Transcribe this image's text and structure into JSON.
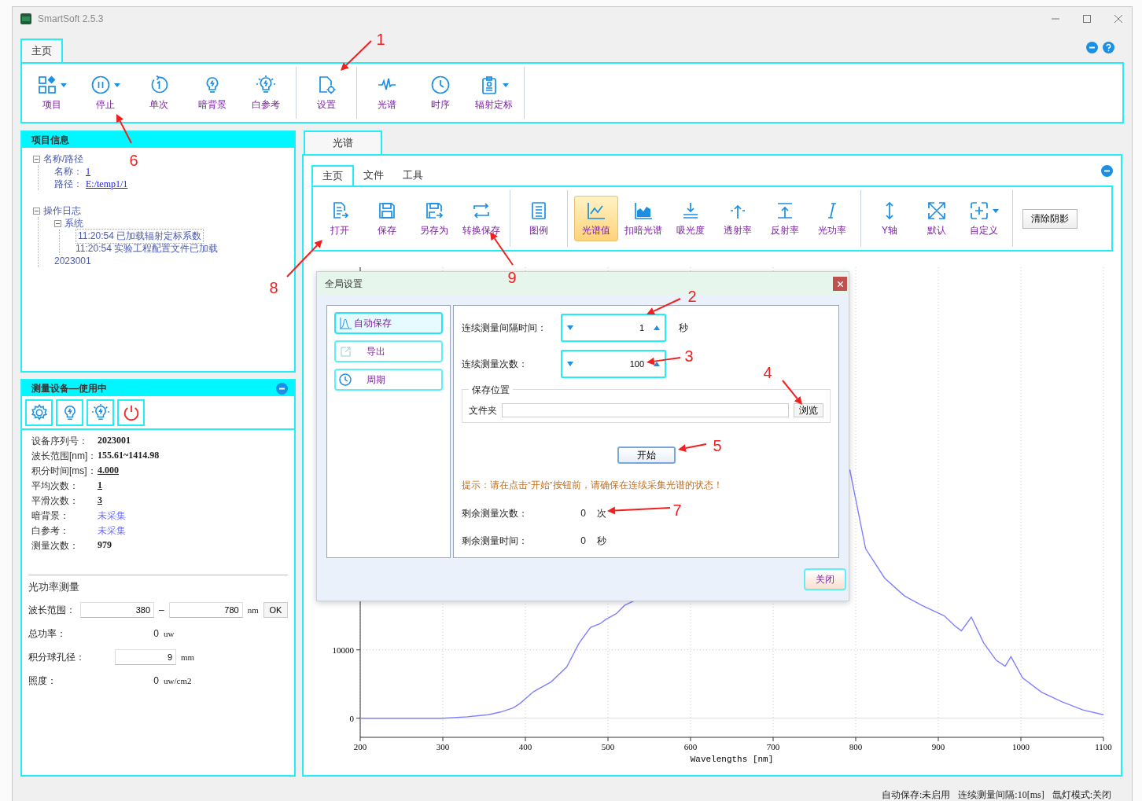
{
  "window": {
    "title": "SmartSoft 2.5.3"
  },
  "ribbon": {
    "tabs": [
      {
        "label": "主页",
        "selected": true
      }
    ],
    "groups": [
      [
        {
          "label": "项目",
          "dropdown": true
        },
        {
          "label": "停止",
          "dropdown": true
        },
        {
          "label": "单次",
          "dropdown": false
        },
        {
          "label": "暗背景",
          "dropdown": false
        },
        {
          "label": "白参考",
          "dropdown": false
        }
      ],
      [
        {
          "label": "设置",
          "dropdown": false
        }
      ],
      [
        {
          "label": "光谱",
          "dropdown": false
        },
        {
          "label": "时序",
          "dropdown": false
        },
        {
          "label": "辐射定标",
          "dropdown": true
        }
      ]
    ]
  },
  "project_panel": {
    "title": "项目信息",
    "tree": [
      {
        "label": "名称/路径",
        "expanded": true,
        "children": [
          {
            "label": "名称：",
            "value": "1"
          },
          {
            "label": "路径：",
            "value": "E:/temp1/1"
          }
        ]
      },
      {
        "label": "操作日志",
        "expanded": true,
        "children": [
          {
            "label": "系统",
            "expanded": true,
            "children": [
              {
                "label": "11:20:54 已加载辐射定标系数",
                "selected": true
              },
              {
                "label": "11:20:54 实验工程配置文件已加载",
                "selected": false
              }
            ]
          },
          {
            "label": "2023001"
          }
        ]
      }
    ]
  },
  "device_panel": {
    "title": "测量设备—使用中",
    "info": [
      {
        "label": "设备序列号：",
        "value": "2023001",
        "kind": "plain"
      },
      {
        "label": "波长范围[nm]：",
        "value": "155.61~1414.98",
        "kind": "plain"
      },
      {
        "label": "积分时间[ms]：",
        "value": "4.000",
        "kind": "link"
      },
      {
        "label": "平均次数：",
        "value": "1",
        "kind": "link"
      },
      {
        "label": "平滑次数：",
        "value": "3",
        "kind": "link"
      },
      {
        "label": "暗背景：",
        "value": "未采集",
        "kind": "status"
      },
      {
        "label": "白参考：",
        "value": "未采集",
        "kind": "status"
      },
      {
        "label": "测量次数：",
        "value": "979",
        "kind": "plain"
      }
    ],
    "power": {
      "title": "光功率测量",
      "range_label": "波长范围：",
      "from": "380",
      "separator": "–",
      "to": "780",
      "unit": "nm",
      "ok": "OK",
      "rows": [
        {
          "kind": "readout",
          "label": "总功率：",
          "value": "0",
          "unit": "uw"
        },
        {
          "kind": "input",
          "label": "积分球孔径：",
          "value": "9",
          "unit": "mm"
        },
        {
          "kind": "readout",
          "label": "照度：",
          "value": "0",
          "unit": "uw/cm2"
        }
      ]
    }
  },
  "spectrum": {
    "tabs": [
      {
        "label": "光谱",
        "selected": true
      }
    ],
    "subtabs": [
      {
        "label": "主页",
        "selected": true
      },
      {
        "label": "文件",
        "selected": false
      },
      {
        "label": "工具",
        "selected": false
      }
    ],
    "toolbar": {
      "groups": [
        [
          {
            "label": "打开",
            "selected": false
          },
          {
            "label": "保存",
            "selected": false
          },
          {
            "label": "另存为",
            "selected": false
          },
          {
            "label": "转换保存",
            "selected": false
          }
        ],
        [
          {
            "label": "图例",
            "selected": false
          }
        ],
        [
          {
            "label": "光谱值",
            "selected": true
          },
          {
            "label": "扣暗光谱",
            "selected": false
          },
          {
            "label": "吸光度",
            "selected": false
          },
          {
            "label": "透射率",
            "selected": false
          },
          {
            "label": "反射率",
            "selected": false
          },
          {
            "label": "光功率",
            "selected": false
          }
        ],
        [
          {
            "label": "Y轴",
            "selected": false
          },
          {
            "label": "默认",
            "selected": false
          },
          {
            "label": "自定义",
            "selected": false,
            "dropdown": true
          }
        ]
      ],
      "clear_button": "清除阴影"
    },
    "chart_data": {
      "type": "line",
      "grid": true,
      "xlabel": "Wavelengths [nm]",
      "xlim": [
        200,
        1100
      ],
      "ylim": [
        -2800,
        66000
      ],
      "xticks": [
        200,
        300,
        400,
        500,
        600,
        700,
        800,
        900,
        1000,
        1100
      ],
      "yticks": [
        0,
        10000
      ],
      "x": [
        200,
        250,
        300,
        330,
        345,
        355,
        370,
        385,
        393,
        410,
        431,
        450,
        465,
        479,
        490,
        498,
        510,
        520,
        532,
        793,
        812,
        835,
        859,
        880,
        907,
        920,
        928,
        940,
        955,
        970,
        981,
        988,
        1002,
        1025,
        1050,
        1075,
        1100
      ],
      "series": [
        {
          "color": "#8080ff",
          "values": [
            0,
            0,
            0,
            200,
            400,
            500,
            900,
            1500,
            2100,
            3900,
            5300,
            7500,
            11000,
            13300,
            13800,
            14500,
            15300,
            16500,
            17200,
            36300,
            24800,
            20500,
            17900,
            16500,
            15000,
            13500,
            12800,
            14800,
            11000,
            8500,
            7600,
            9000,
            5900,
            3800,
            2400,
            1200,
            500
          ]
        }
      ]
    }
  },
  "dialog": {
    "title": "全局设置",
    "nav": [
      {
        "label": "自动保存",
        "selected": true
      },
      {
        "label": "导出",
        "selected": false
      },
      {
        "label": "周期",
        "selected": false
      }
    ],
    "fields": [
      {
        "label": "连续测量间隔时间：",
        "value": "1",
        "unit": "秒"
      },
      {
        "label": "连续测量次数：",
        "value": "100"
      }
    ],
    "save_location": {
      "title": "保存位置",
      "label": "文件夹",
      "browse": "浏览"
    },
    "start": "开始",
    "hint": "提示：请在点击“开始”按钮前，请确保在连续采集光谱的状态！",
    "remaining": [
      {
        "label": "剩余测量次数：",
        "value": "0",
        "unit": "次"
      },
      {
        "label": "剩余测量时间：",
        "value": "0",
        "unit": "秒"
      }
    ],
    "close": "关闭"
  },
  "status_bar": [
    "自动保存:未启用",
    "连续测量间隔:10[ms]",
    "氙灯模式:关闭"
  ],
  "annotations": [
    {
      "label": "1"
    },
    {
      "label": "2"
    },
    {
      "label": "3"
    },
    {
      "label": "4"
    },
    {
      "label": "5"
    },
    {
      "label": "6"
    },
    {
      "label": "7"
    },
    {
      "label": "8"
    },
    {
      "label": "9"
    }
  ]
}
